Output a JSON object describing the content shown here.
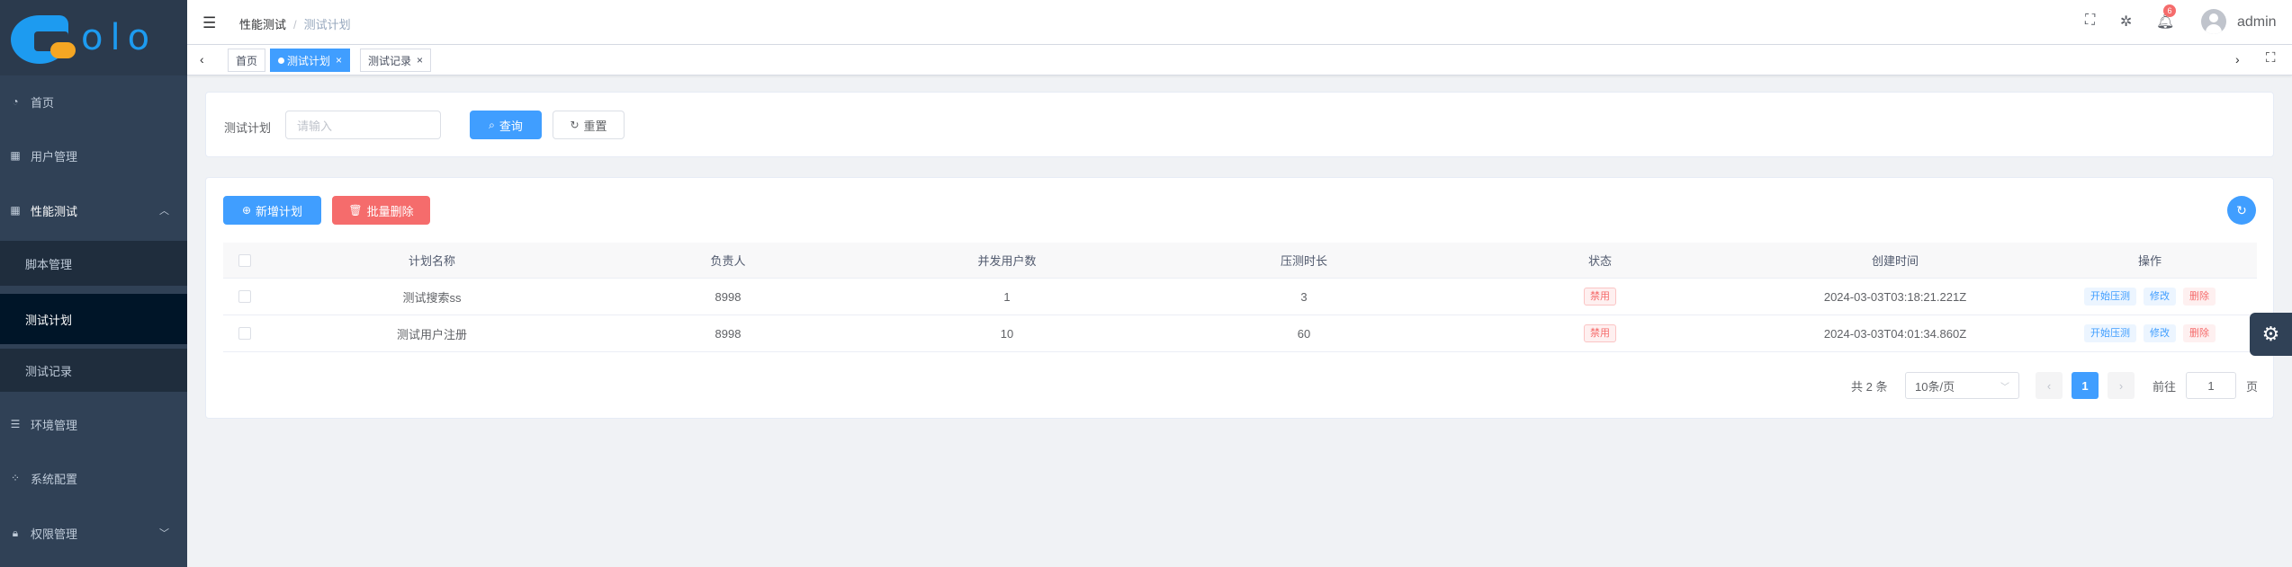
{
  "logo": {
    "text": "olo"
  },
  "sidebar": {
    "items": [
      {
        "label": "首页",
        "icon": "dashboard-icon"
      },
      {
        "label": "用户管理",
        "icon": "user-grid-icon"
      },
      {
        "label": "性能测试",
        "icon": "grid-icon",
        "expanded": true
      },
      {
        "label": "脚本管理",
        "sub": true
      },
      {
        "label": "测试计划",
        "sub": true,
        "active": true
      },
      {
        "label": "测试记录",
        "sub": true
      },
      {
        "label": "环境管理",
        "icon": "list-icon"
      },
      {
        "label": "系统配置",
        "icon": "component-icon"
      },
      {
        "label": "权限管理",
        "icon": "lock-icon"
      }
    ]
  },
  "header": {
    "breadcrumb": [
      "性能测试",
      "测试计划"
    ],
    "notification_count": "6",
    "username": "admin"
  },
  "tags": [
    {
      "label": "首页"
    },
    {
      "label": "测试计划",
      "active": true
    },
    {
      "label": "测试记录"
    }
  ],
  "search": {
    "label": "测试计划",
    "placeholder": "请输入",
    "query_label": "查询",
    "reset_label": "重置"
  },
  "toolbar": {
    "add_label": "新增计划",
    "batch_delete_label": "批量删除"
  },
  "table": {
    "columns": [
      "计划名称",
      "负责人",
      "并发用户数",
      "压测时长",
      "状态",
      "创建时间",
      "操作"
    ],
    "rows": [
      {
        "name": "测试搜索ss",
        "owner": "8998",
        "users": "1",
        "duration": "3",
        "status": "禁用",
        "created": "2024-03-03T03:18:21.221Z"
      },
      {
        "name": "测试用户注册",
        "owner": "8998",
        "users": "10",
        "duration": "60",
        "status": "禁用",
        "created": "2024-03-03T04:01:34.860Z"
      }
    ],
    "actions": [
      "开始压测",
      "修改",
      "删除"
    ]
  },
  "pagination": {
    "total": "共 2 条",
    "page_size": "10条/页",
    "current": "1",
    "goto_prefix": "前往",
    "goto_value": "1",
    "goto_suffix": "页"
  },
  "colors": {
    "primary": "#409eff",
    "danger": "#f56c6c",
    "sidebar": "#304156"
  }
}
